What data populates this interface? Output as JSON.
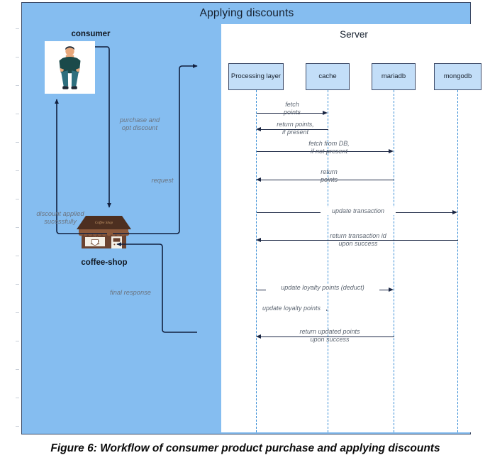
{
  "diagram": {
    "title": "Applying discounts",
    "server_title": "Server",
    "caption": "Figure 6: Workflow of consumer product purchase and applying discounts",
    "colors": {
      "panel_blue": "#85bdf0",
      "panel_border": "#3b4a66",
      "box_fill": "#c3def8",
      "box_border": "#3d4a68",
      "lifeline": "#3b8fd6",
      "arrow": "#1b2744",
      "label_text": "#5d6672"
    }
  },
  "actors": [
    {
      "id": "consumer",
      "label": "consumer",
      "icon": "person-icon"
    },
    {
      "id": "coffee-shop",
      "label": "coffee-shop",
      "icon": "coffee-shop-icon",
      "sign": "Coffee Shop"
    }
  ],
  "lifelines": [
    {
      "id": "processing-layer",
      "label": "Processing layer"
    },
    {
      "id": "cache",
      "label": "cache"
    },
    {
      "id": "mariadb",
      "label": "mariadb"
    },
    {
      "id": "mongodb",
      "label": "mongodb"
    }
  ],
  "external_flows": [
    {
      "id": "purchase",
      "label": "purchase and\nopt discount",
      "from": "consumer",
      "to": "coffee-shop"
    },
    {
      "id": "request",
      "label": "request",
      "from": "coffee-shop",
      "to": "processing-layer"
    },
    {
      "id": "discount-applied",
      "label": "discount applied\nsucessfully",
      "from": "coffee-shop",
      "to": "consumer"
    },
    {
      "id": "final-response",
      "label": "final response",
      "from": "processing-layer",
      "to": "coffee-shop"
    }
  ],
  "messages": [
    {
      "id": "fetch-points",
      "label": "fetch\npoints",
      "from": "processing-layer",
      "to": "cache",
      "direction": "right"
    },
    {
      "id": "return-points-if-present",
      "label": "return points,\nif present",
      "from": "cache",
      "to": "processing-layer",
      "direction": "left"
    },
    {
      "id": "fetch-from-db",
      "label": "fetch from DB,\nif not present",
      "from": "processing-layer",
      "to": "mariadb",
      "direction": "right"
    },
    {
      "id": "return-points",
      "label": "return\npoints",
      "from": "mariadb",
      "to": "processing-layer",
      "direction": "left"
    },
    {
      "id": "update-transaction",
      "label": "update transaction",
      "from": "processing-layer",
      "to": "mongodb",
      "direction": "right"
    },
    {
      "id": "return-transaction-id",
      "label": "return transaction id\nupon success",
      "from": "mongodb",
      "to": "processing-layer",
      "direction": "left"
    },
    {
      "id": "update-loyalty-points-deduct",
      "label": "update loyalty points (deduct)",
      "from": "processing-layer",
      "to": "mariadb",
      "direction": "right"
    },
    {
      "id": "update-loyalty-points",
      "label": "update loyalty points",
      "from": "processing-layer",
      "to": "cache",
      "direction": "right"
    },
    {
      "id": "return-updated-points",
      "label": "return updated points\nupon success",
      "from": "mariadb",
      "to": "processing-layer",
      "direction": "left"
    }
  ]
}
